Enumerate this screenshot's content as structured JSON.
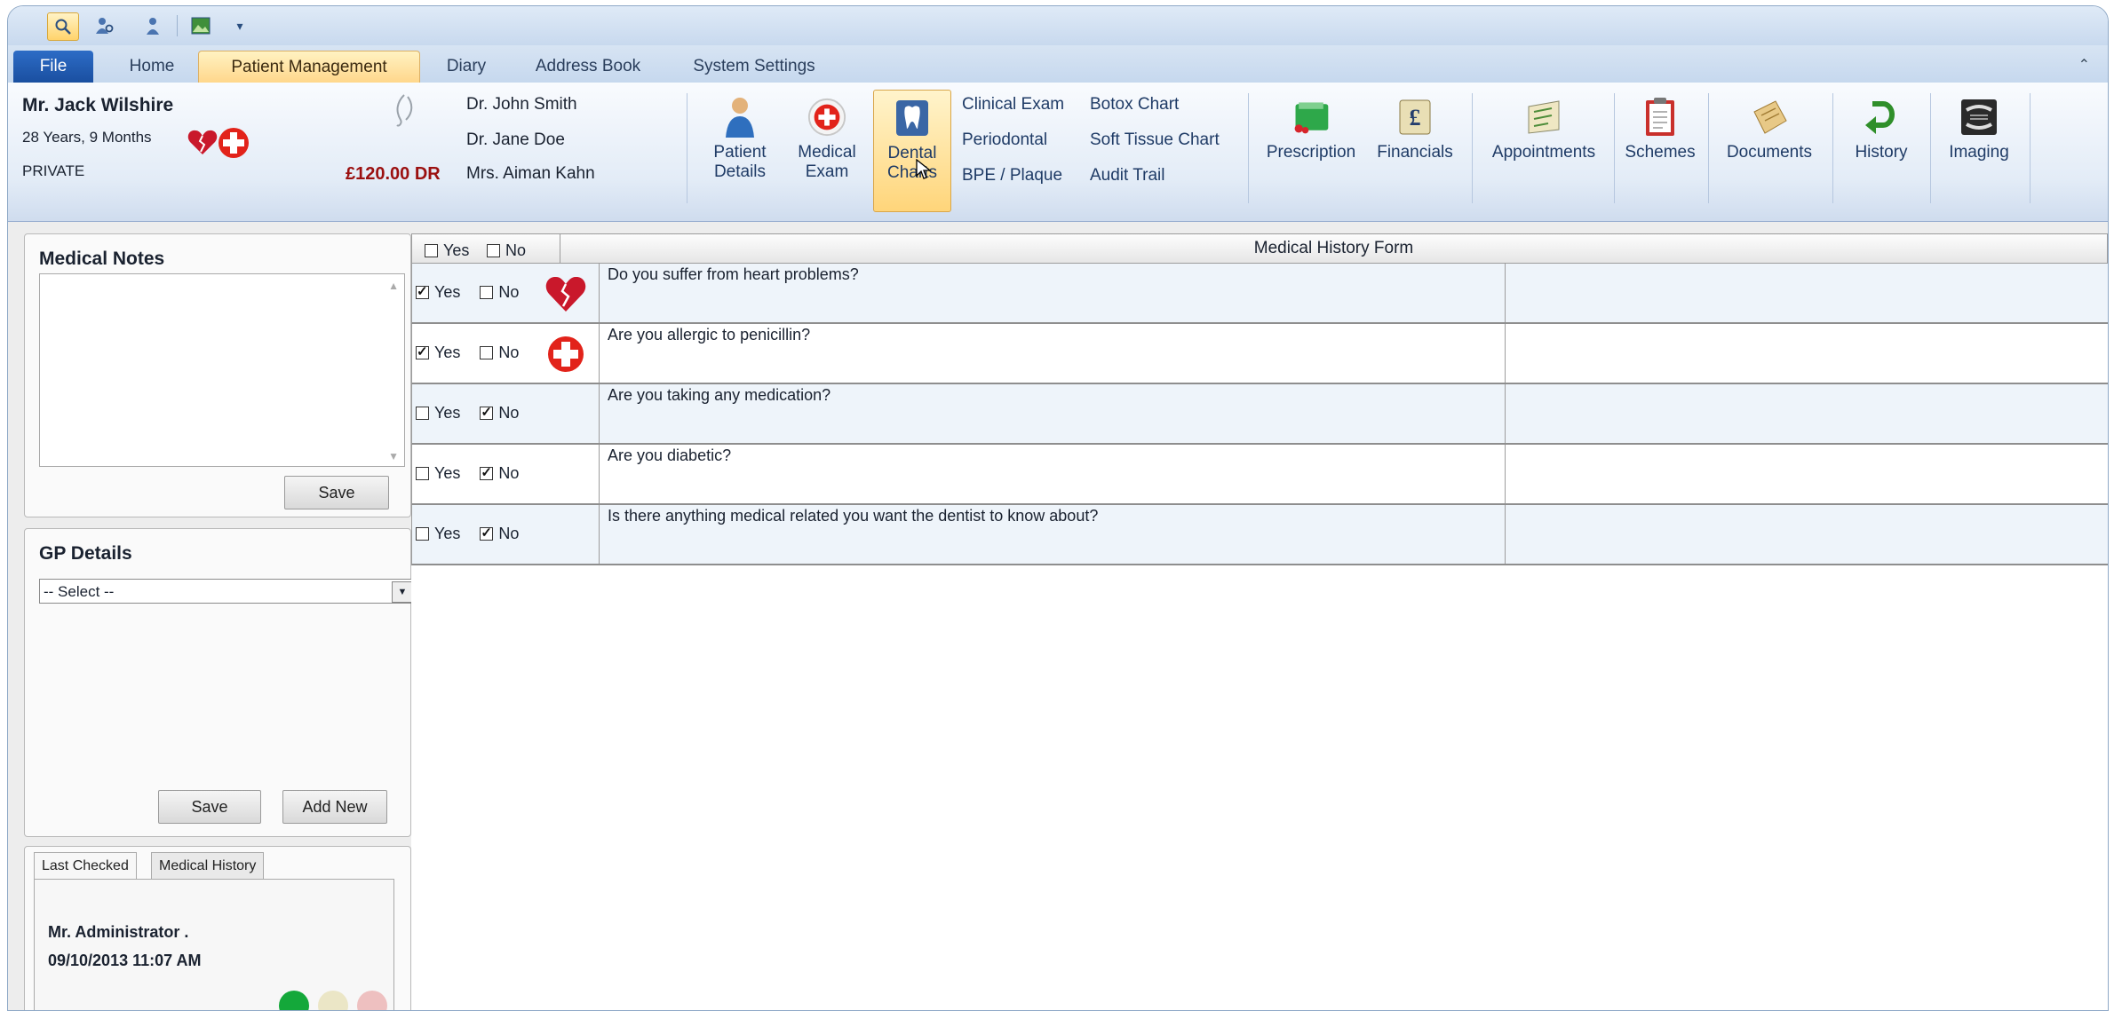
{
  "tabs": {
    "file": "File",
    "home": "Home",
    "patient_management": "Patient Management",
    "diary": "Diary",
    "address_book": "Address Book",
    "system_settings": "System Settings"
  },
  "patient": {
    "name": "Mr. Jack Wilshire",
    "age": "28 Years, 9 Months",
    "type": "PRIVATE",
    "balance": "£120.00 DR"
  },
  "clinicians": [
    "Dr. John Smith",
    "Dr. Jane Doe",
    "Mrs. Aiman Kahn"
  ],
  "ribbon": {
    "patient_details": [
      "Patient",
      "Details"
    ],
    "medical_exam": [
      "Medical",
      "Exam"
    ],
    "dental_charts": [
      "Dental",
      "Charts"
    ],
    "links_col1": [
      "Clinical Exam",
      "Periodontal",
      "BPE / Plaque"
    ],
    "links_col2": [
      "Botox Chart",
      "Soft Tissue Chart",
      "Audit Trail"
    ],
    "prescription": "Prescription",
    "financials": "Financials",
    "appointments": "Appointments",
    "schemes": "Schemes",
    "documents": "Documents",
    "history": "History",
    "imaging": "Imaging"
  },
  "medical_notes": {
    "title": "Medical Notes",
    "value": "",
    "save": "Save"
  },
  "gp_details": {
    "title": "GP Details",
    "select_value": "-- Select --",
    "save": "Save",
    "add_new": "Add New"
  },
  "bottom_panel": {
    "tabs": [
      "Last Checked",
      "Medical History"
    ],
    "checked_by": "Mr. Administrator .",
    "checked_at": "09/10/2013 11:07 AM",
    "status_colors": [
      "#14a83a",
      "#ebe6c6",
      "#eec0c0"
    ]
  },
  "grid": {
    "header_yes": "Yes",
    "header_no": "No",
    "title": "Medical History Form",
    "yes_label": "Yes",
    "no_label": "No",
    "rows": [
      {
        "question": "Do you suffer from heart problems?",
        "yes": true,
        "no": false,
        "icon": "broken-heart-icon"
      },
      {
        "question": "Are you allergic to penicillin?",
        "yes": true,
        "no": false,
        "icon": "red-cross-icon"
      },
      {
        "question": "Are you taking any medication?",
        "yes": false,
        "no": true,
        "icon": ""
      },
      {
        "question": "Are you diabetic?",
        "yes": false,
        "no": true,
        "icon": ""
      },
      {
        "question": "Is there anything medical related you want the dentist to know about?",
        "yes": false,
        "no": true,
        "icon": ""
      }
    ]
  }
}
